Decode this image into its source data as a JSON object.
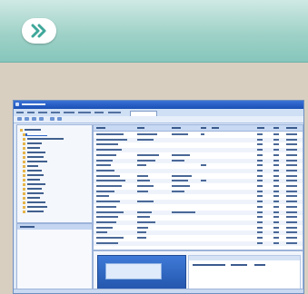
{
  "header": {
    "nav_icon": "double-chevron-right-icon",
    "colors": {
      "bar": "#9fd2c8",
      "icon": "#3fa79a"
    }
  },
  "app": {
    "icon_names": [
      "app-icon",
      "folder-icon",
      "toolbar-icon",
      "search-icon"
    ]
  }
}
